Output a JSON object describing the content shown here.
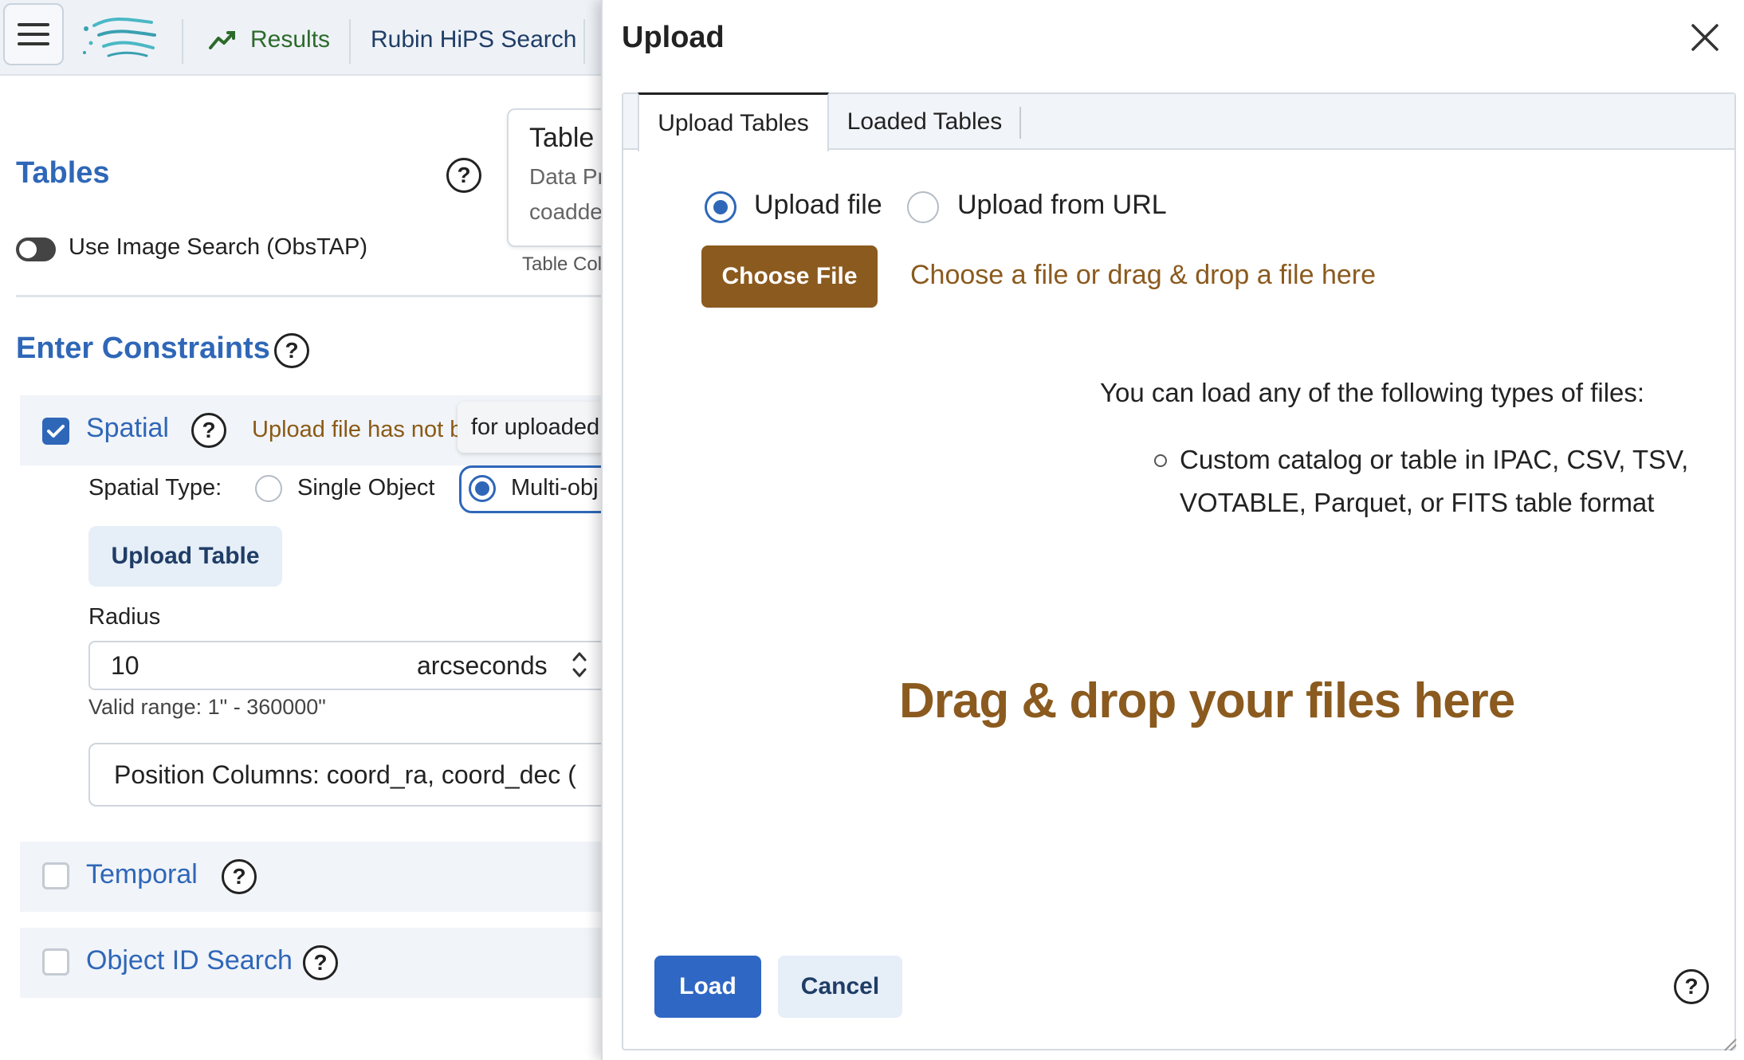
{
  "topbar": {
    "menu_icon": "hamburger-icon",
    "logo_icon": "app-logo-icon",
    "tabs": [
      {
        "label": "Results",
        "icon": "chart-line-icon",
        "color": "#2d6a2b"
      },
      {
        "label": "Rubin HiPS Search"
      }
    ]
  },
  "left": {
    "tables_title": "Tables",
    "help_glyph": "?",
    "toggle_label": "Use Image Search (ObsTAP)",
    "table_card": {
      "title": "Table (",
      "line1": "Data Pr",
      "line2": "coadde"
    },
    "table_col_label": "Table Col",
    "constraints_title": "Enter Constraints",
    "spatial": {
      "label": "Spatial",
      "checked": true,
      "warning": "Upload file has not b",
      "tooltip": "for uploaded table",
      "type_label": "Spatial Type:",
      "single_object": "Single Object",
      "multi_object": "Multi-obj",
      "upload_table": "Upload Table",
      "radius_label": "Radius",
      "radius_value": "10",
      "radius_unit": "arcseconds",
      "valid_range": "Valid range: 1\" - 360000\"",
      "position_columns": "Position Columns:   coord_ra, coord_dec   ("
    },
    "temporal": {
      "label": "Temporal",
      "checked": false
    },
    "object_id": {
      "label": "Object ID Search",
      "checked": false
    }
  },
  "dialog": {
    "title": "Upload",
    "close_icon": "close-icon",
    "tabs": [
      {
        "label": "Upload Tables",
        "active": true
      },
      {
        "label": "Loaded Tables",
        "active": false
      }
    ],
    "source_options": [
      {
        "label": "Upload file",
        "selected": true
      },
      {
        "label": "Upload from URL",
        "selected": false
      }
    ],
    "choose_file": "Choose File",
    "choose_hint": "Choose a file or drag & drop a file here",
    "types_intro": "You can load any of the following types of files:",
    "types_line1": "Custom catalog or table in IPAC, CSV, TSV,",
    "types_line2": "VOTABLE, Parquet, or FITS table format",
    "drag_drop": "Drag & drop your files here",
    "load": "Load",
    "cancel": "Cancel"
  },
  "colors": {
    "accent": "#2f67b8",
    "brown": "#8b5a1e",
    "load_button": "#2f67c4"
  }
}
